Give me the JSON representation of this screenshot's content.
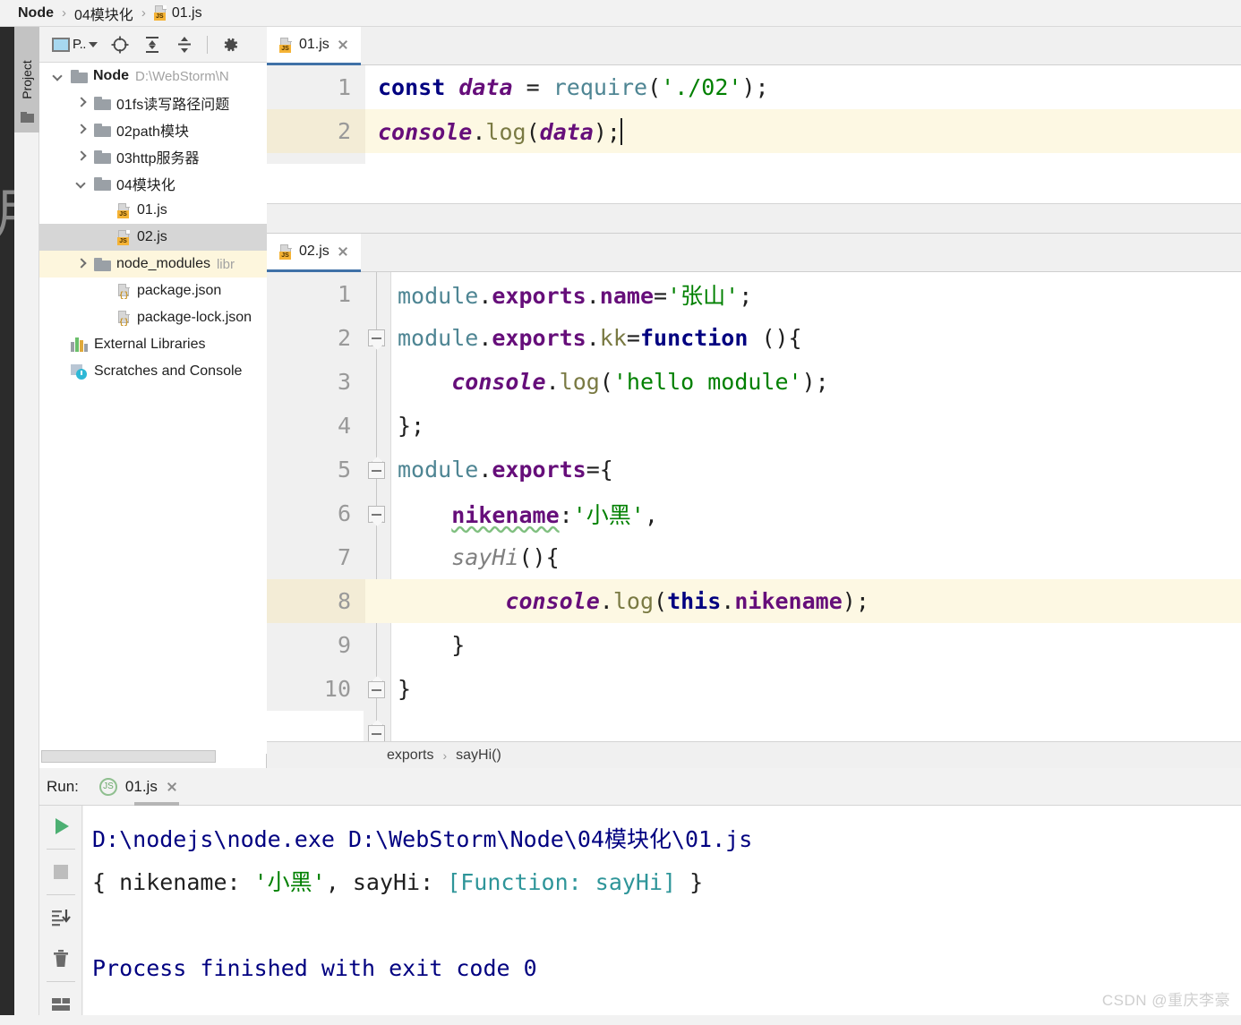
{
  "breadcrumb": {
    "project": "Node",
    "folder": "04模块化",
    "file": "01.js",
    "sep": "›"
  },
  "toolwindow_tab": {
    "label": "Project"
  },
  "project_toolbar": {
    "project_selector_label": "P..",
    "icons": [
      "locate-icon",
      "expand-all-icon",
      "collapse-all-icon",
      "gear-icon"
    ]
  },
  "tree": {
    "items": [
      {
        "label": "Node",
        "sub": "D:\\WebStorm\\N",
        "indent": 0,
        "arrow": "down",
        "icon": "folder-icon",
        "bold": true,
        "state": "normal"
      },
      {
        "label": "01fs读写路径问题",
        "sub": "",
        "indent": 1,
        "arrow": "right",
        "icon": "folder-icon",
        "bold": false,
        "state": "normal"
      },
      {
        "label": "02path模块",
        "sub": "",
        "indent": 1,
        "arrow": "right",
        "icon": "folder-icon",
        "bold": false,
        "state": "normal"
      },
      {
        "label": "03http服务器",
        "sub": "",
        "indent": 1,
        "arrow": "right",
        "icon": "folder-icon",
        "bold": false,
        "state": "normal"
      },
      {
        "label": "04模块化",
        "sub": "",
        "indent": 1,
        "arrow": "down",
        "icon": "folder-icon",
        "bold": false,
        "state": "normal"
      },
      {
        "label": "01.js",
        "sub": "",
        "indent": 2,
        "arrow": "none",
        "icon": "js-file-icon",
        "bold": false,
        "state": "normal"
      },
      {
        "label": "02.js",
        "sub": "",
        "indent": 2,
        "arrow": "none",
        "icon": "js-file-icon",
        "bold": false,
        "state": "selected"
      },
      {
        "label": "node_modules",
        "sub": "libr",
        "indent": 1,
        "arrow": "right",
        "icon": "folder-icon",
        "bold": false,
        "state": "highlight"
      },
      {
        "label": "package.json",
        "sub": "",
        "indent": 2,
        "arrow": "none",
        "icon": "json-file-icon",
        "bold": false,
        "state": "normal"
      },
      {
        "label": "package-lock.json",
        "sub": "",
        "indent": 2,
        "arrow": "none",
        "icon": "json-file-icon",
        "bold": false,
        "state": "normal"
      },
      {
        "label": "External Libraries",
        "sub": "",
        "indent": 0,
        "arrow": "none",
        "icon": "libraries-icon",
        "bold": false,
        "state": "normal"
      },
      {
        "label": "Scratches and Console",
        "sub": "",
        "indent": 0,
        "arrow": "none",
        "icon": "scratches-icon",
        "bold": false,
        "state": "normal"
      }
    ]
  },
  "editor_top": {
    "tab_label": "01.js",
    "lines": [
      {
        "no": "1",
        "current": false
      },
      {
        "no": "2",
        "current": true
      }
    ],
    "code_line_1": "const data = require('./02');",
    "code_line_2": "console.log(data);"
  },
  "editor_bottom": {
    "tab_label": "02.js",
    "lines": [
      "1",
      "2",
      "3",
      "4",
      "5",
      "6",
      "7",
      "8",
      "9",
      "10"
    ],
    "current_line": "8",
    "code": [
      "module.exports.name='张山';",
      "module.exports.kk=function (){",
      "    console.log('hello module');",
      "};",
      "module.exports={",
      "    nikename:'小黑',",
      "    sayHi(){",
      "        console.log(this.nikename);",
      "    }",
      "}"
    ],
    "breadcrumb": {
      "first": "exports",
      "sep": "›",
      "second": "sayHi()"
    }
  },
  "run_panel": {
    "label": "Run:",
    "tab_label": "01.js",
    "side_buttons": [
      "run-icon",
      "stop-icon",
      "scroll-to-end-icon",
      "trash-icon",
      "layout-icon"
    ],
    "output": [
      "D:\\nodejs\\node.exe D:\\WebStorm\\Node\\04模块化\\01.js",
      "{ nikename: '小黑', sayHi: [Function: sayHi] }",
      "",
      "Process finished with exit code 0"
    ],
    "output_parts": {
      "line1": "D:\\nodejs\\node.exe D:\\WebStorm\\Node\\04模块化\\01.js",
      "line2_open": "{ nikename: ",
      "line2_str": "'小黑'",
      "line2_mid": ", sayHi: ",
      "line2_fn": "[Function: sayHi]",
      "line2_close": " }",
      "line4": "Process finished with exit code 0"
    }
  },
  "watermark": "CSDN @重庆李豪",
  "colors": {
    "accent_tab_underline": "#4071a7",
    "selection_gray": "#d6d6d6",
    "current_line_yellow": "#fdf8e3",
    "string_green": "#008000",
    "keyword_navy": "#000080",
    "property_purple": "#660e7a",
    "object_teal": "#4e8593",
    "function_olive": "#7a7a43",
    "console_navy": "#000080",
    "console_teal": "#2e9599"
  }
}
